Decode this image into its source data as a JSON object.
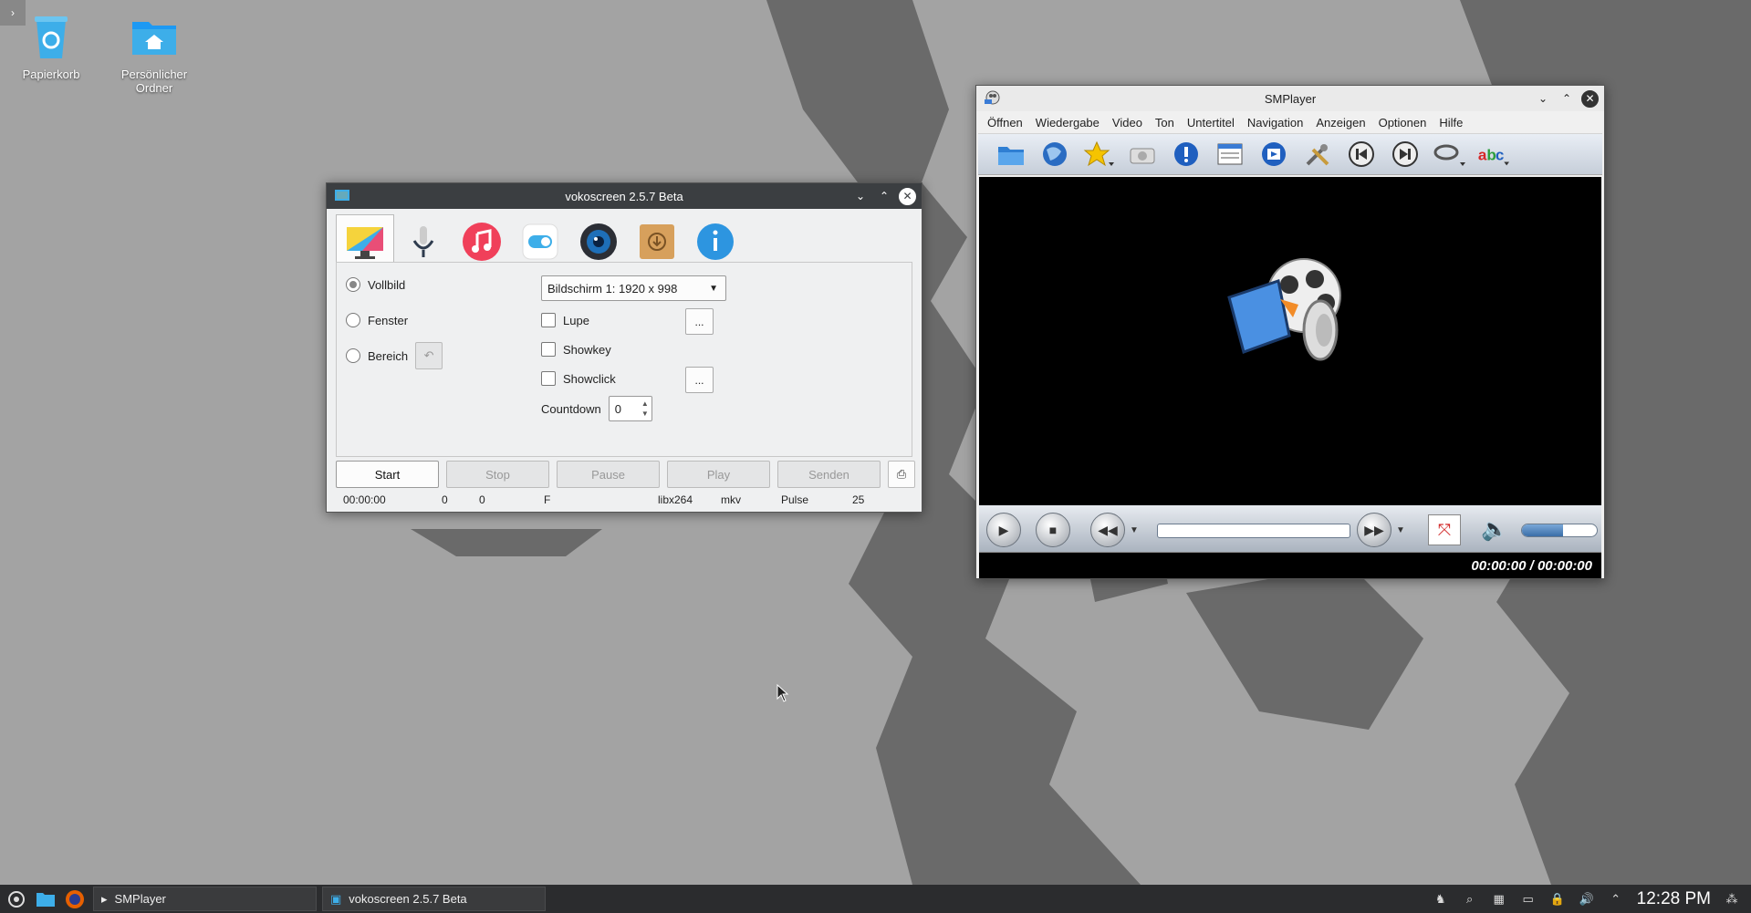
{
  "desktop": {
    "icons": [
      {
        "label": "Papierkorb"
      },
      {
        "label": "Persönlicher Ordner"
      }
    ]
  },
  "vokoscreen": {
    "title": "vokoscreen 2.5.7 Beta",
    "tabs": [
      "screen-tab",
      "audio-tab",
      "codec-tab",
      "settings-tab",
      "webcam-tab",
      "player-tab",
      "info-tab"
    ],
    "radios": {
      "vollbild": "Vollbild",
      "fenster": "Fenster",
      "bereich": "Bereich"
    },
    "screen_select": "Bildschirm 1:  1920 x 998",
    "checks": {
      "lupe": "Lupe",
      "showkey": "Showkey",
      "showclick": "Showclick"
    },
    "countdown_label": "Countdown",
    "countdown_value": "0",
    "ellipsis": "...",
    "buttons": {
      "start": "Start",
      "stop": "Stop",
      "pause": "Pause",
      "play": "Play",
      "senden": "Senden"
    },
    "status": {
      "time": "00:00:00",
      "a": "0",
      "b": "0",
      "c": "F",
      "codec": "libx264",
      "format": "mkv",
      "audio": "Pulse",
      "fps": "25"
    }
  },
  "smplayer": {
    "title": "SMPlayer",
    "menu": [
      "Öffnen",
      "Wiedergabe",
      "Video",
      "Ton",
      "Untertitel",
      "Navigation",
      "Anzeigen",
      "Optionen",
      "Hilfe"
    ],
    "time": "00:00:00 / 00:00:00",
    "volume": 0.55
  },
  "taskbar": {
    "tasks": [
      "SMPlayer",
      "vokoscreen 2.5.7 Beta"
    ],
    "clock": "12:28 PM"
  },
  "colors": {
    "accent": "#3daee9",
    "titlebar_dark": "#3b3e41",
    "taskbar": "#2b2c2e"
  }
}
